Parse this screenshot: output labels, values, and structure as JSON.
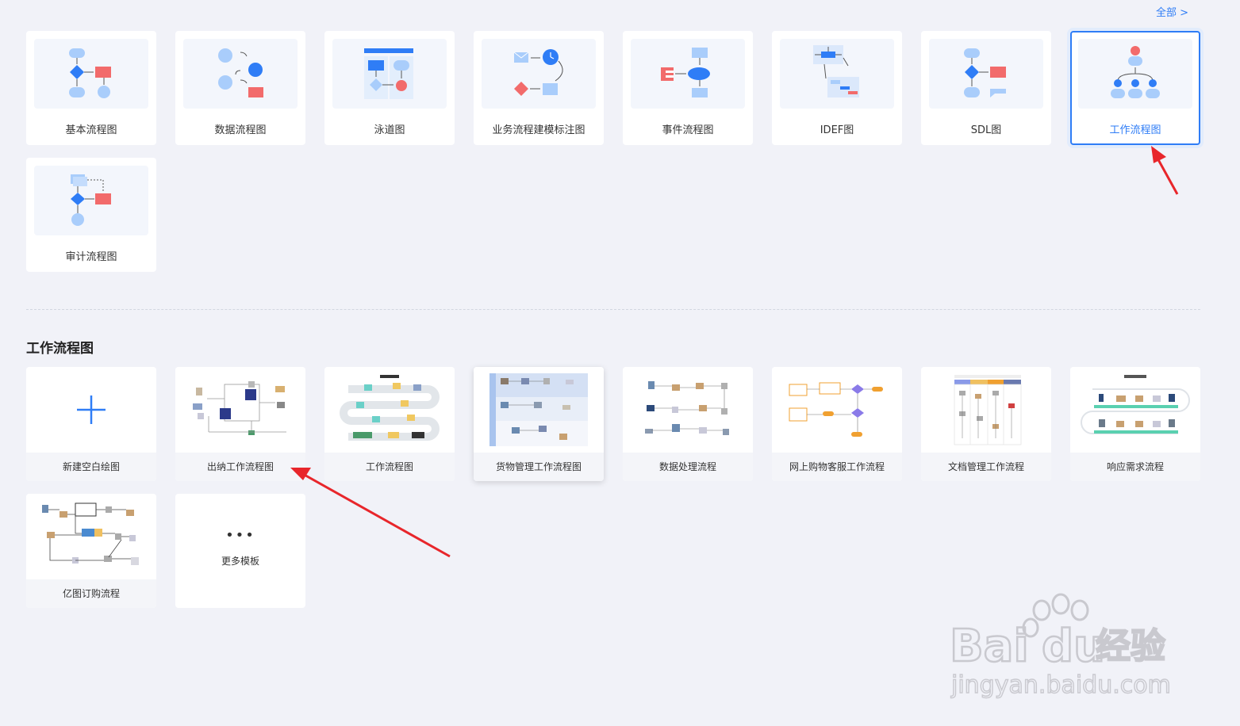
{
  "header": {
    "all_link": "全部 >"
  },
  "categories": [
    {
      "label": "基本流程图"
    },
    {
      "label": "数据流程图"
    },
    {
      "label": "泳道图"
    },
    {
      "label": "业务流程建模标注图"
    },
    {
      "label": "事件流程图"
    },
    {
      "label": "IDEF图"
    },
    {
      "label": "SDL图"
    },
    {
      "label": "工作流程图",
      "selected": true
    },
    {
      "label": "审计流程图"
    }
  ],
  "section": {
    "title": "工作流程图"
  },
  "templates": [
    {
      "label": "新建空白绘图"
    },
    {
      "label": "出纳工作流程图"
    },
    {
      "label": "工作流程图"
    },
    {
      "label": "货物管理工作流程图"
    },
    {
      "label": "数据处理流程"
    },
    {
      "label": "网上购物客服工作流程"
    },
    {
      "label": "文档管理工作流程"
    },
    {
      "label": "响应需求流程"
    },
    {
      "label": "亿图订购流程"
    }
  ],
  "more": {
    "dots": "•••",
    "label": "更多模板"
  },
  "colors": {
    "accent": "#2f7df6",
    "shape_red": "#f26b6b",
    "shape_light": "#a9cdfb",
    "arrow_red": "#e8262b"
  },
  "watermark": {
    "brand": "Bai",
    "brand2": "du",
    "cn": "经验",
    "url": "jingyan.baidu.com"
  }
}
